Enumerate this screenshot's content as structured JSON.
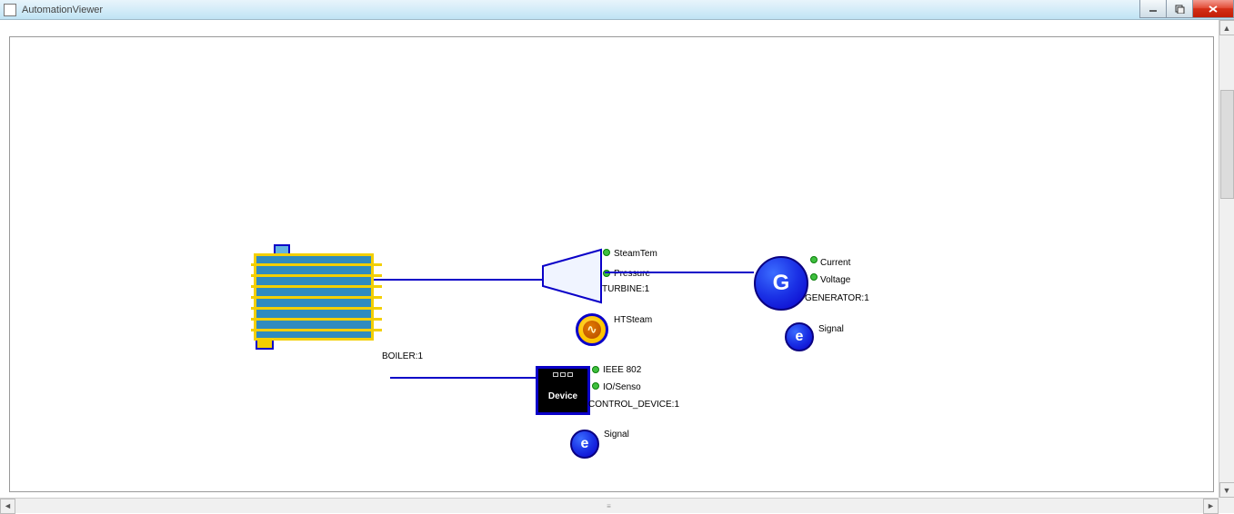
{
  "window": {
    "title": "AutomationViewer"
  },
  "nodes": {
    "boiler": {
      "label": "BOILER:1"
    },
    "turbine": {
      "label": "TURBINE:1",
      "ports": {
        "steamtemp": "SteamTem",
        "pressure": "Pressure"
      }
    },
    "htsteam": {
      "label": "HTSteam",
      "glyph": "∿"
    },
    "device": {
      "label": "CONTROL_DEVICE:1",
      "caption": "Device",
      "ports": {
        "ieee": "IEEE 802",
        "io": "IO/Senso"
      }
    },
    "generator": {
      "label": "GENERATOR:1",
      "glyph": "G",
      "ports": {
        "current": "Current",
        "voltage": "Voltage"
      }
    },
    "e1": {
      "glyph": "e",
      "label": "Signal"
    },
    "e2": {
      "glyph": "e",
      "label": "Signal"
    }
  },
  "colors": {
    "wire": "#0a00c8",
    "port": "#3fbf3f",
    "accentYellow": "#f3cf00",
    "boilerFill": "#2f8bbf"
  }
}
